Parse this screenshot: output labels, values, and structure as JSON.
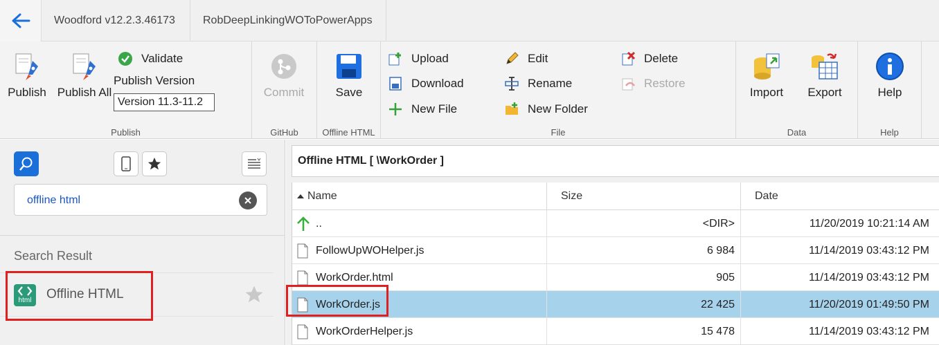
{
  "titlebar": {
    "tabs": [
      "Woodford v12.2.3.46173",
      "RobDeepLinkingWOToPowerApps"
    ]
  },
  "ribbon": {
    "publish_group": {
      "label": "Publish",
      "publish": "Publish",
      "publish_all": "Publish All",
      "validate": "Validate",
      "publish_version_label": "Publish Version",
      "version_value": "Version 11.3-11.2"
    },
    "github_group": {
      "label": "GitHub",
      "commit": "Commit"
    },
    "offline_group": {
      "label": "Offline HTML",
      "save": "Save"
    },
    "file_group": {
      "label": "File",
      "upload": "Upload",
      "download": "Download",
      "new_file": "New File",
      "edit": "Edit",
      "rename": "Rename",
      "new_folder": "New Folder",
      "delete": "Delete",
      "restore": "Restore"
    },
    "data_group": {
      "label": "Data",
      "import": "Import",
      "export": "Export"
    },
    "help_group": {
      "label": "Help",
      "help": "Help"
    }
  },
  "left": {
    "search_value": "offline html",
    "search_result_label": "Search Result",
    "result_item": "Offline HTML",
    "result_icon_text": "html"
  },
  "right": {
    "path": "Offline HTML [ \\WorkOrder ]",
    "columns": {
      "name": "Name",
      "size": "Size",
      "date": "Date"
    },
    "rows": [
      {
        "name": "..",
        "size": "<DIR>",
        "date": "11/20/2019 10:21:14 AM"
      },
      {
        "name": "FollowUpWOHelper.js",
        "size": "6 984",
        "date": "11/14/2019 03:43:12 PM"
      },
      {
        "name": "WorkOrder.html",
        "size": "905",
        "date": "11/14/2019 03:43:12 PM"
      },
      {
        "name": "WorkOrder.js",
        "size": "22 425",
        "date": "11/20/2019 01:49:50 PM"
      },
      {
        "name": "WorkOrderHelper.js",
        "size": "15 478",
        "date": "11/14/2019 03:43:12 PM"
      }
    ]
  },
  "colors": {
    "accent": "#1a6fd8",
    "selected_row": "#a6d2ec",
    "highlight_box": "#e02020"
  }
}
